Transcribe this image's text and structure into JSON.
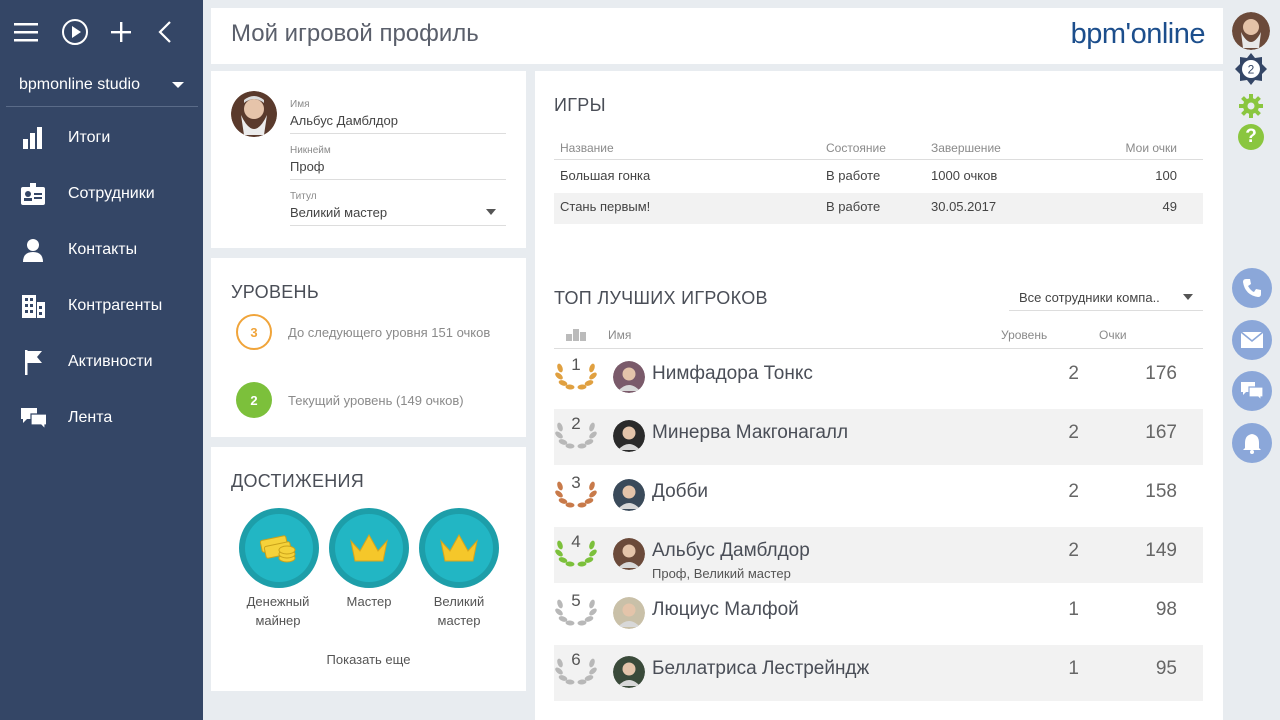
{
  "sidebar": {
    "studio": "bpmonline studio",
    "items": [
      {
        "label": "Итоги"
      },
      {
        "label": "Сотрудники"
      },
      {
        "label": "Контакты"
      },
      {
        "label": "Контрагенты"
      },
      {
        "label": "Активности"
      },
      {
        "label": "Лента"
      }
    ]
  },
  "header": {
    "title": "Мой игровой профиль",
    "logo": "bpm'online"
  },
  "rail": {
    "notification_count": "2"
  },
  "profile": {
    "name_label": "Имя",
    "name_value": "Альбус Дамблдор",
    "nick_label": "Никнейм",
    "nick_value": "Проф",
    "title_label": "Титул",
    "title_value": "Великий мастер"
  },
  "level": {
    "title": "УРОВЕНЬ",
    "next_num": "3",
    "next_text": "До следующего уровня 151 очков",
    "cur_num": "2",
    "cur_text": "Текущий уровень (149 очков)"
  },
  "achievements": {
    "title": "ДОСТИЖЕНИЯ",
    "items": [
      {
        "label1": "Денежный",
        "label2": "майнер"
      },
      {
        "label1": "Мастер",
        "label2": ""
      },
      {
        "label1": "Великий",
        "label2": "мастер"
      }
    ],
    "more": "Показать еще"
  },
  "games": {
    "title": "ИГРЫ",
    "columns": [
      "Название",
      "Состояние",
      "Завершение",
      "Мои очки"
    ],
    "rows": [
      {
        "name": "Большая гонка",
        "state": "В работе",
        "end": "1000 очков",
        "points": "100"
      },
      {
        "name": "Стань первым!",
        "state": "В работе",
        "end": "30.05.2017",
        "points": "49"
      }
    ]
  },
  "top": {
    "title": "ТОП ЛУЧШИХ ИГРОКОВ",
    "filter": "Все сотрудники компа..",
    "columns": [
      "Имя",
      "Уровень",
      "Очки"
    ],
    "rows": [
      {
        "rank": "1",
        "name": "Нимфадора Тонкс",
        "sub": "",
        "level": "2",
        "points": "176"
      },
      {
        "rank": "2",
        "name": "Минерва Макгонагалл",
        "sub": "",
        "level": "2",
        "points": "167"
      },
      {
        "rank": "3",
        "name": "Добби",
        "sub": "",
        "level": "2",
        "points": "158"
      },
      {
        "rank": "4",
        "name": "Альбус Дамблдор",
        "sub": "Проф, Великий мастер",
        "level": "2",
        "points": "149"
      },
      {
        "rank": "5",
        "name": "Люциус Малфой",
        "sub": "",
        "level": "1",
        "points": "98"
      },
      {
        "rank": "6",
        "name": "Беллатриса Лестрейндж",
        "sub": "",
        "level": "1",
        "points": "95"
      }
    ]
  },
  "colors": {
    "sidebar": "#344666",
    "gold": "#e0a040",
    "silver": "#b8b8b8",
    "bronze": "#c87a4a",
    "green": "#7cc03b",
    "accent_blue": "#8ba7d9"
  }
}
